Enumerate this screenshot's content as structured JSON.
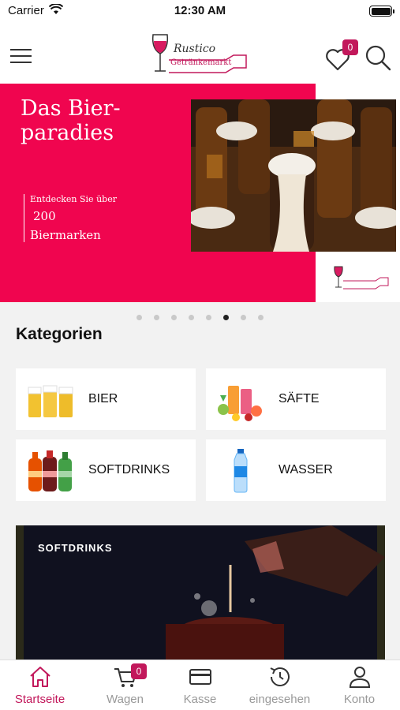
{
  "status_bar": {
    "carrier": "Carrier",
    "time": "12:30 AM"
  },
  "header": {
    "logo_line1": "Rustico",
    "logo_line2": "Getränkemarkt",
    "wishlist_count": "0"
  },
  "banner": {
    "title": "Das Bier-paradies",
    "line1": "Entdecken Sie über",
    "line2": "200",
    "line3": "Biermarken",
    "slide_count": 8,
    "active_slide": 6
  },
  "categories": {
    "title": "Kategorien",
    "items": [
      {
        "label": "BIER",
        "icon": "beer-glasses-icon"
      },
      {
        "label": "SÄFTE",
        "icon": "juice-icon"
      },
      {
        "label": "SOFTDRINKS",
        "icon": "soda-bottles-icon"
      },
      {
        "label": "WASSER",
        "icon": "water-bottle-icon"
      }
    ]
  },
  "promo": {
    "label": "SOFTDRINKS"
  },
  "tabbar": {
    "items": [
      {
        "label": "Startseite",
        "icon": "home-icon",
        "active": true
      },
      {
        "label": "Wagen",
        "icon": "cart-icon",
        "badge": "0"
      },
      {
        "label": "Kasse",
        "icon": "card-icon"
      },
      {
        "label": "eingesehen",
        "icon": "history-icon"
      },
      {
        "label": "Konto",
        "icon": "user-icon"
      }
    ]
  },
  "colors": {
    "accent": "#c2185b",
    "banner_red": "#f0054f"
  }
}
